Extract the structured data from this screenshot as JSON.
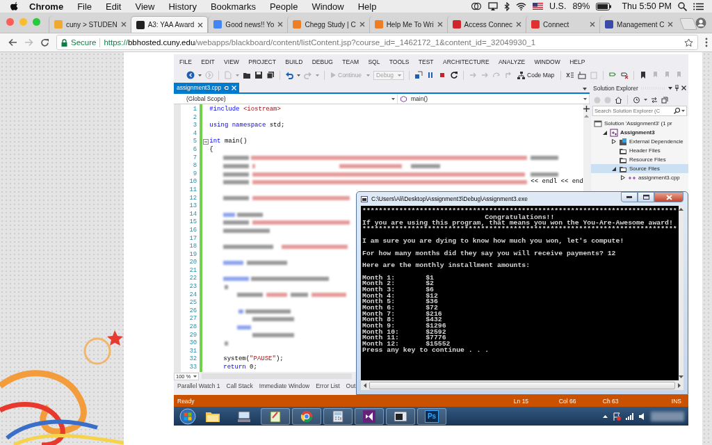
{
  "menubar": {
    "app": "Chrome",
    "items": [
      "File",
      "Edit",
      "View",
      "History",
      "Bookmarks",
      "People",
      "Window",
      "Help"
    ],
    "input_source": "U.S.",
    "battery": "89%",
    "clock": "Thu 5:50 PM"
  },
  "browser": {
    "tabs": [
      {
        "title": "cuny > STUDEN",
        "selected": false,
        "color": "#f0a830"
      },
      {
        "title": "A3: YAA Award",
        "selected": true,
        "color": "#222222"
      },
      {
        "title": "Good news!! Yo",
        "selected": false,
        "color": "#4285f4"
      },
      {
        "title": "Chegg Study | C",
        "selected": false,
        "color": "#ef7d22"
      },
      {
        "title": "Help Me To Wri",
        "selected": false,
        "color": "#ef7d22"
      },
      {
        "title": "Access Connec",
        "selected": false,
        "color": "#d2232a"
      },
      {
        "title": "Connect",
        "selected": false,
        "color": "#e03030"
      },
      {
        "title": "Management C",
        "selected": false,
        "color": "#3a4aa8"
      }
    ],
    "security": "Secure",
    "url": {
      "scheme": "https://",
      "host": "bbhosted.cuny.edu",
      "path": "/webapps/blackboard/content/listContent.jsp?course_id=_1462172_1&content_id=_32049930_1"
    }
  },
  "ide": {
    "menu": [
      "FILE",
      "EDIT",
      "VIEW",
      "PROJECT",
      "BUILD",
      "DEBUG",
      "TEAM",
      "SQL",
      "TOOLS",
      "TEST",
      "ARCHITECTURE",
      "ANALYZE",
      "WINDOW",
      "HELP"
    ],
    "toolbar": {
      "continue": {
        "label": "Continue",
        "disabled": true
      },
      "configuration": {
        "value": "Debug",
        "disabled": true
      },
      "code_map": "Code Map"
    },
    "doc_tabs": [
      {
        "title": "assignment3.cpp",
        "selected": true
      }
    ],
    "scope": "(Global Scope)",
    "member": "main()",
    "lines": [
      {
        "number": "1",
        "segments": [
          {
            "kind": "keyword",
            "text": "#include"
          },
          {
            "kind": "string",
            "text": " <iostream>"
          }
        ]
      },
      {
        "number": "2"
      },
      {
        "number": "3",
        "segments": [
          {
            "kind": "keyword",
            "text": "using namespace"
          },
          {
            "kind": "plain",
            "text": " std;"
          }
        ]
      },
      {
        "number": "4"
      },
      {
        "number": "5",
        "expanded": true,
        "segments": [
          {
            "kind": "keyword",
            "text": "int"
          },
          {
            "kind": "plain",
            "text": " main()"
          }
        ]
      },
      {
        "number": "6",
        "segments": [
          {
            "kind": "plain",
            "text": "{"
          }
        ]
      },
      {
        "number": "7",
        "segments": [
          {
            "kind": "blur-plain"
          },
          {
            "kind": "blur-string"
          },
          {
            "kind": "blur-plain"
          }
        ]
      },
      {
        "number": "8",
        "segments": [
          {
            "kind": "blur-plain"
          },
          {
            "kind": "blur-string"
          },
          {
            "kind": "blur-string"
          },
          {
            "kind": "blur-plain"
          }
        ]
      },
      {
        "number": "9",
        "segments": [
          {
            "kind": "blur-plain"
          },
          {
            "kind": "blur-string"
          },
          {
            "kind": "blur-plain"
          }
        ]
      },
      {
        "number": "10",
        "segments": [
          {
            "kind": "blur-plain"
          },
          {
            "kind": "blur-string"
          },
          {
            "kind": "plain",
            "text": "<< endl << end"
          }
        ]
      },
      {
        "number": "11"
      },
      {
        "number": "12",
        "segments": [
          {
            "kind": "blur-plain"
          },
          {
            "kind": "blur-string"
          }
        ]
      },
      {
        "number": "13"
      },
      {
        "number": "14",
        "segments": [
          {
            "kind": "blur-keyword"
          },
          {
            "kind": "blur-plain"
          }
        ]
      },
      {
        "number": "15",
        "segments": [
          {
            "kind": "blur-plain"
          },
          {
            "kind": "blur-string"
          }
        ]
      },
      {
        "number": "16",
        "segments": [
          {
            "kind": "blur-plain"
          }
        ]
      },
      {
        "number": "17"
      },
      {
        "number": "18",
        "segments": [
          {
            "kind": "blur-plain"
          },
          {
            "kind": "blur-string"
          }
        ]
      },
      {
        "number": "19"
      },
      {
        "number": "20",
        "segments": [
          {
            "kind": "blur-keyword"
          },
          {
            "kind": "blur-plain"
          }
        ]
      },
      {
        "number": "21"
      },
      {
        "number": "22",
        "segments": [
          {
            "kind": "blur-keyword"
          },
          {
            "kind": "blur-plain"
          }
        ]
      },
      {
        "number": "23",
        "segments": [
          {
            "kind": "blur-plain"
          }
        ]
      },
      {
        "number": "24",
        "segments": [
          {
            "kind": "blur-plain"
          },
          {
            "kind": "blur-string"
          },
          {
            "kind": "blur-plain"
          },
          {
            "kind": "blur-string"
          }
        ]
      },
      {
        "number": "25"
      },
      {
        "number": "26",
        "segments": [
          {
            "kind": "blur-keyword"
          },
          {
            "kind": "blur-plain"
          }
        ]
      },
      {
        "number": "27",
        "segments": [
          {
            "kind": "blur-plain"
          }
        ]
      },
      {
        "number": "28",
        "segments": [
          {
            "kind": "blur-keyword"
          }
        ]
      },
      {
        "number": "29",
        "segments": [
          {
            "kind": "blur-plain"
          }
        ]
      },
      {
        "number": "30",
        "segments": [
          {
            "kind": "blur-plain"
          }
        ]
      },
      {
        "number": "31"
      },
      {
        "number": "32",
        "segments": [
          {
            "kind": "plain",
            "text": "system("
          },
          {
            "kind": "string",
            "text": "\"PAUSE\""
          },
          {
            "kind": "plain",
            "text": ");"
          }
        ]
      },
      {
        "number": "33",
        "segments": [
          {
            "kind": "keyword",
            "text": "return"
          },
          {
            "kind": "plain",
            "text": " 0;"
          }
        ]
      }
    ],
    "zoom": "100 %",
    "tool_tabs": [
      "Parallel Watch 1",
      "Call Stack",
      "Immediate Window",
      "Error List",
      "Out"
    ],
    "status": {
      "text": "Ready",
      "line": "Ln 15",
      "column": "Col 66",
      "char": "Ch 63",
      "mode": "INS"
    },
    "solution_explorer": {
      "title": "Solution Explorer",
      "search_placeholder": "Search Solution Explorer (C",
      "tree": [
        {
          "label": "Solution 'Assignment3' (1 pr",
          "kind": "solution",
          "selected": false,
          "children": [
            {
              "label": "Assignment3",
              "kind": "project",
              "selected": false,
              "expanded": true,
              "children": [
                {
                  "label": "External Dependencie",
                  "kind": "dependencies",
                  "selected": false,
                  "expanded": false
                },
                {
                  "label": "Header Files",
                  "kind": "folder",
                  "selected": false
                },
                {
                  "label": "Resource Files",
                  "kind": "folder",
                  "selected": false
                },
                {
                  "label": "Source Files",
                  "kind": "folder",
                  "selected": true,
                  "expanded": true,
                  "children": [
                    {
                      "label": "assignment3.cpp",
                      "kind": "file",
                      "selected": false,
                      "expanded": false
                    }
                  ]
                }
              ]
            }
          ]
        }
      ]
    },
    "taskbar": {
      "app_label": "Ps"
    }
  },
  "console": {
    "title": "C:\\Users\\Ali\\Desktop\\Assignment3\\Debug\\Assignment3.exe",
    "banner": {
      "top_rule": "*****************************************************************************",
      "heading": "Congratulations!!",
      "message": "If you are using this program, that means you won the You-Are-Awesome award!",
      "bottom_rule": "*****************************************************************************"
    },
    "paragraphs": [
      "I am sure you are dying to know how much you won, let's compute!",
      "For how many months did they say you will receive payments? 12",
      "Here are the monthly installment amounts:"
    ],
    "installments": [
      {
        "month": "Month 1:",
        "amount": "$1"
      },
      {
        "month": "Month 2:",
        "amount": "$2"
      },
      {
        "month": "Month 3:",
        "amount": "$6"
      },
      {
        "month": "Month 4:",
        "amount": "$12"
      },
      {
        "month": "Month 5:",
        "amount": "$36"
      },
      {
        "month": "Month 6:",
        "amount": "$72"
      },
      {
        "month": "Month 7:",
        "amount": "$216"
      },
      {
        "month": "Month 8:",
        "amount": "$432"
      },
      {
        "month": "Month 9:",
        "amount": "$1296"
      },
      {
        "month": "Month 10:",
        "amount": "$2592"
      },
      {
        "month": "Month 11:",
        "amount": "$7776"
      },
      {
        "month": "Month 12:",
        "amount": "$15552"
      }
    ],
    "prompt": "Press any key to continue . . ."
  }
}
